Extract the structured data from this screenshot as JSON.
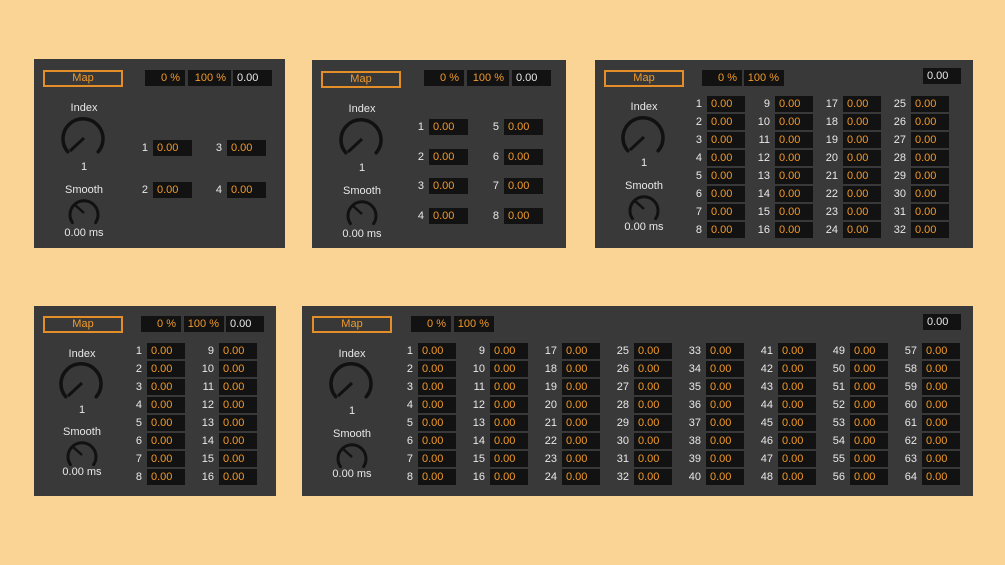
{
  "labels": {
    "map": "Map",
    "min_pct": "0 %",
    "max_pct": "100 %",
    "output": "0.00",
    "index": "Index",
    "index_value": "1",
    "smooth": "Smooth",
    "smooth_value": "0.00 ms"
  },
  "slot_value": "0.00",
  "panels": [
    {
      "id": "four",
      "slots": 4
    },
    {
      "id": "eight",
      "slots": 8
    },
    {
      "id": "thirtytwo",
      "slots": 32
    },
    {
      "id": "sixteen",
      "slots": 16
    },
    {
      "id": "sixtyfour",
      "slots": 64
    }
  ],
  "colors": {
    "background": "#fad495",
    "panel": "#393939",
    "accent": "#f29a2a",
    "field": "#121212",
    "text": "#e8e8e8"
  }
}
